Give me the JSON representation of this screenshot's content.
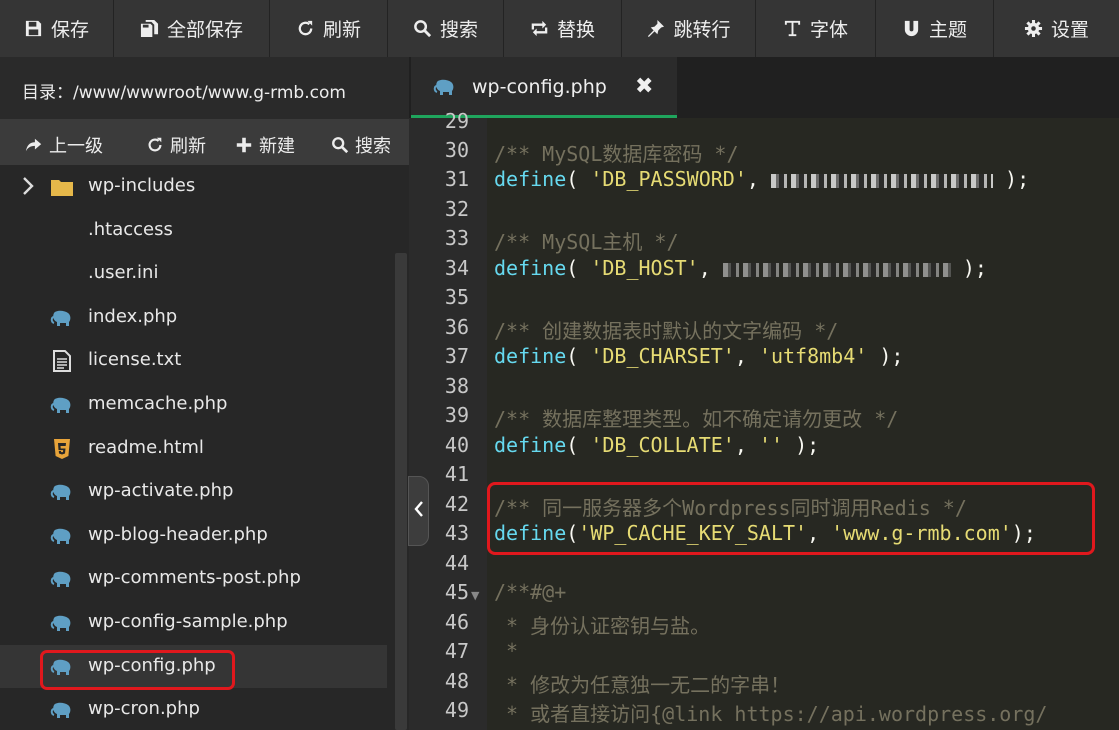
{
  "toolbar": {
    "save": "保存",
    "save_all": "全部保存",
    "refresh": "刷新",
    "search": "搜索",
    "replace": "替换",
    "goto_line": "跳转行",
    "font": "字体",
    "theme": "主题",
    "settings": "设置"
  },
  "sidebar": {
    "dir_label": "目录：/www/wwwroot/www.g-rmb.com",
    "nav": {
      "up": "上一级",
      "refresh": "刷新",
      "new": "新建",
      "search": "搜索"
    },
    "files": [
      {
        "name": "wp-includes",
        "type": "folder"
      },
      {
        "name": ".htaccess",
        "type": "plain"
      },
      {
        "name": ".user.ini",
        "type": "plain"
      },
      {
        "name": "index.php",
        "type": "php"
      },
      {
        "name": "license.txt",
        "type": "txt"
      },
      {
        "name": "memcache.php",
        "type": "php"
      },
      {
        "name": "readme.html",
        "type": "html"
      },
      {
        "name": "wp-activate.php",
        "type": "php"
      },
      {
        "name": "wp-blog-header.php",
        "type": "php"
      },
      {
        "name": "wp-comments-post.php",
        "type": "php"
      },
      {
        "name": "wp-config-sample.php",
        "type": "php"
      },
      {
        "name": "wp-config.php",
        "type": "php",
        "selected": true
      },
      {
        "name": "wp-cron.php",
        "type": "php"
      }
    ]
  },
  "editor": {
    "tab_name": "wp-config.php",
    "close_glyph": "✖",
    "collapse_glyph": "‹",
    "line_numbers": [
      "29",
      "30",
      "31",
      "32",
      "33",
      "34",
      "35",
      "36",
      "37",
      "38",
      "39",
      "40",
      "41",
      "42",
      "43",
      "44",
      "45",
      "46",
      "47",
      "48",
      "49"
    ],
    "lines": {
      "c30": "/** MySQL数据库密码 */",
      "d31a": "define",
      "d31b": "( ",
      "d31c": "'DB_PASSWORD'",
      "d31d": ", ",
      "d31e": " );",
      "c33": "/** MySQL主机 */",
      "d34a": "define",
      "d34b": "( ",
      "d34c": "'DB_HOST'",
      "d34d": ", ",
      "d34e": " );",
      "c36": "/** 创建数据表时默认的文字编码 */",
      "d37a": "define",
      "d37b": "( ",
      "d37c": "'DB_CHARSET'",
      "d37d": ", ",
      "d37e": "'utf8mb4'",
      "d37f": " );",
      "c39": "/** 数据库整理类型。如不确定请勿更改 */",
      "d40a": "define",
      "d40b": "( ",
      "d40c": "'DB_COLLATE'",
      "d40d": ", ",
      "d40e": "''",
      "d40f": " );",
      "c42": "/** 同一服务器多个Wordpress同时调用Redis */",
      "d43a": "define",
      "d43b": "(",
      "d43c": "'WP_CACHE_KEY_SALT'",
      "d43d": ", ",
      "d43e": "'www.g-rmb.com'",
      "d43f": ");",
      "c45": "/**#@+",
      "c46": " * 身份认证密钥与盐。",
      "c47": " *",
      "c48": " * 修改为任意独一无二的字串！",
      "c49": " * 或者直接访问{@link https://api.wordpress.org/"
    }
  },
  "colors": {
    "accent_green": "#1fa55d",
    "highlight_red": "#e0181d",
    "comment": "#75715e",
    "keyword": "#66d9ef",
    "string": "#e6db74",
    "folder": "#e6b84a",
    "php_icon": "#5f9fc4",
    "html_icon": "#e8a43a"
  }
}
